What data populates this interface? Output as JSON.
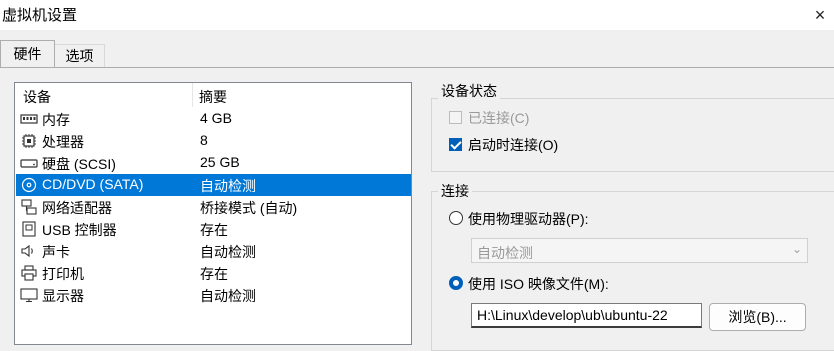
{
  "window": {
    "title": "虚拟机设置",
    "close_glyph": "×"
  },
  "tabs": [
    {
      "label": "硬件"
    },
    {
      "label": "选项"
    }
  ],
  "device_list": {
    "headers": {
      "device": "设备",
      "summary": "摘要"
    },
    "rows": [
      {
        "name": "内存",
        "summary": "4 GB",
        "icon": "memory-icon"
      },
      {
        "name": "处理器",
        "summary": "8",
        "icon": "processor-icon"
      },
      {
        "name": "硬盘 (SCSI)",
        "summary": "25 GB",
        "icon": "hard-disk-icon"
      },
      {
        "name": "CD/DVD (SATA)",
        "summary": "自动检测",
        "icon": "cd-dvd-icon",
        "selected": true
      },
      {
        "name": "网络适配器",
        "summary": "桥接模式 (自动)",
        "icon": "network-adapter-icon"
      },
      {
        "name": "USB 控制器",
        "summary": "存在",
        "icon": "usb-controller-icon"
      },
      {
        "name": "声卡",
        "summary": "自动检测",
        "icon": "sound-card-icon"
      },
      {
        "name": "打印机",
        "summary": "存在",
        "icon": "printer-icon"
      },
      {
        "name": "显示器",
        "summary": "自动检测",
        "icon": "display-icon"
      }
    ]
  },
  "device_status": {
    "label": "设备状态",
    "connected": {
      "label": "已连接(C)",
      "checked": false,
      "enabled": false
    },
    "connect_at_power_on": {
      "label": "启动时连接(O)",
      "checked": true,
      "enabled": true
    }
  },
  "connection": {
    "label": "连接",
    "physical_drive": {
      "label": "使用物理驱动器(P):",
      "selected": false
    },
    "physical_drive_select": {
      "value": "自动检测",
      "enabled": false
    },
    "iso_file": {
      "label": "使用 ISO 映像文件(M):",
      "selected": true
    },
    "iso_path": {
      "value": "H:\\Linux\\develop\\ub\\ubuntu-22"
    },
    "browse_button": {
      "label": "浏览(B)..."
    }
  },
  "colors": {
    "selection": "#0078d7",
    "accent": "#005fb8"
  }
}
